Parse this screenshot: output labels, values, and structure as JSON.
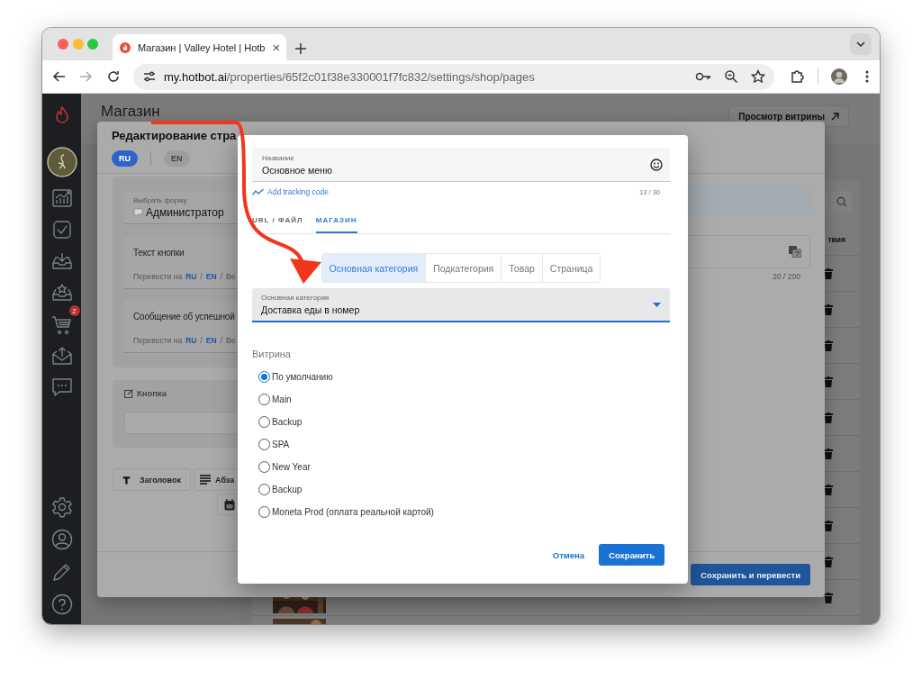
{
  "browser": {
    "tab_title": "Магазин | Valley Hotel | Hotb",
    "url_host": "my.hotbot.ai",
    "url_path": "/properties/65f2c01f38e330001f7fc832/settings/shop/pages"
  },
  "sidebar": {
    "cart_badge": "2"
  },
  "page": {
    "title": "Магазин",
    "view_button": "Просмотр витрины",
    "column_header": "твия"
  },
  "editor": {
    "title": "Редактирование стра",
    "languages": [
      {
        "label": "RU",
        "selected": true
      },
      {
        "label": "EN",
        "selected": false
      }
    ],
    "form_select": {
      "label": "Выбрать форму",
      "value": "Администратор"
    },
    "text_fields": [
      {
        "label": "Текст кнопки",
        "translate_label": "Перевести на",
        "links": [
          "RU",
          "EN"
        ],
        "separator": "/",
        "cut_text": "Ве"
      },
      {
        "label": "Сообщение об успешной",
        "translate_label": "Перевести на",
        "links": [
          "RU",
          "EN"
        ],
        "separator": "/",
        "cut_text": "Ве"
      }
    ],
    "button_section": {
      "title": "Кнопка"
    },
    "blocks": [
      "Заголовок",
      "Абза"
    ],
    "counter": "20 / 200",
    "save_translate_button": "Сохранить и перевести"
  },
  "dialog": {
    "name_field": {
      "label": "Название",
      "value": "Основное меню"
    },
    "tracking_link": "Add tracking code",
    "name_counter": "13 / 30",
    "tabs": [
      {
        "label": "URL / ФАЙЛ",
        "selected": false
      },
      {
        "label": "МАГАЗИН",
        "selected": true
      }
    ],
    "segments": [
      {
        "label": "Основная категория",
        "selected": true
      },
      {
        "label": "Подкатегория",
        "selected": false
      },
      {
        "label": "Товар",
        "selected": false
      },
      {
        "label": "Страница",
        "selected": false
      }
    ],
    "category_select": {
      "label": "Основная категория",
      "value": "Доставка еды в номер"
    },
    "showcase": {
      "title": "Витрина",
      "options": [
        {
          "label": "По умолчанию",
          "selected": true
        },
        {
          "label": "Main",
          "selected": false
        },
        {
          "label": "Backup",
          "selected": false
        },
        {
          "label": "SPA",
          "selected": false
        },
        {
          "label": "New Year",
          "selected": false
        },
        {
          "label": "Backup",
          "selected": false
        },
        {
          "label": "Moneta Prod (оплата реальной картой)",
          "selected": false
        }
      ]
    },
    "buttons": {
      "cancel": "Отмена",
      "save": "Сохранить"
    }
  }
}
